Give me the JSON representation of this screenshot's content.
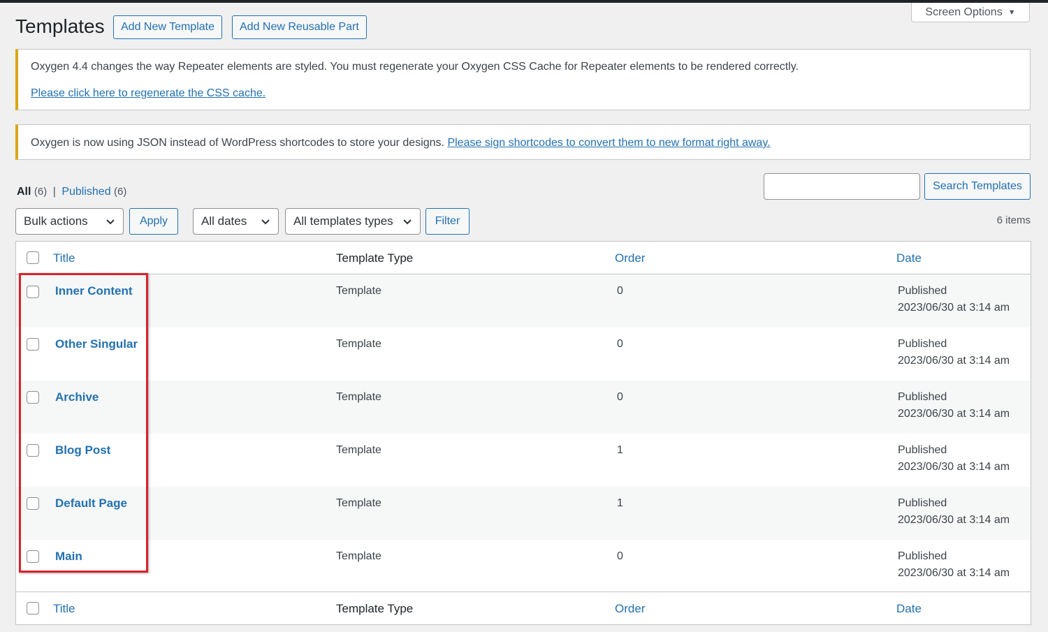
{
  "header": {
    "title": "Templates",
    "add_new_template": "Add New Template",
    "add_new_reusable_part": "Add New Reusable Part",
    "screen_options": "Screen Options"
  },
  "notices": {
    "css_cache": {
      "message": "Oxygen 4.4 changes the way Repeater elements are styled. You must regenerate your Oxygen CSS Cache for Repeater elements to be rendered correctly.",
      "link": "Please click here to regenerate the CSS cache."
    },
    "json": {
      "message": "Oxygen is now using JSON instead of WordPress shortcodes to store your designs.",
      "link": "Please sign shortcodes to convert them to new format right away."
    }
  },
  "views": {
    "all_label": "All",
    "all_count": "(6)",
    "separator": "|",
    "published_label": "Published",
    "published_count": "(6)"
  },
  "search": {
    "value": "",
    "button": "Search Templates"
  },
  "filters": {
    "bulk_actions": "Bulk actions",
    "apply": "Apply",
    "dates": "All dates",
    "template_types": "All templates types",
    "filter": "Filter",
    "items_count": "6 items"
  },
  "table": {
    "columns": {
      "title": "Title",
      "template_type": "Template Type",
      "order": "Order",
      "date": "Date"
    },
    "rows": [
      {
        "title": "Inner Content",
        "type": "Template",
        "order": "0",
        "status": "Published",
        "date": "2023/06/30 at 3:14 am"
      },
      {
        "title": "Other Singular",
        "type": "Template",
        "order": "0",
        "status": "Published",
        "date": "2023/06/30 at 3:14 am"
      },
      {
        "title": "Archive",
        "type": "Template",
        "order": "0",
        "status": "Published",
        "date": "2023/06/30 at 3:14 am"
      },
      {
        "title": "Blog Post",
        "type": "Template",
        "order": "1",
        "status": "Published",
        "date": "2023/06/30 at 3:14 am"
      },
      {
        "title": "Default Page",
        "type": "Template",
        "order": "1",
        "status": "Published",
        "date": "2023/06/30 at 3:14 am"
      },
      {
        "title": "Main",
        "type": "Template",
        "order": "0",
        "status": "Published",
        "date": "2023/06/30 at 3:14 am"
      }
    ]
  },
  "colors": {
    "accent": "#2271b1",
    "notice_warning": "#dba617",
    "highlight_box": "#d9222a"
  }
}
